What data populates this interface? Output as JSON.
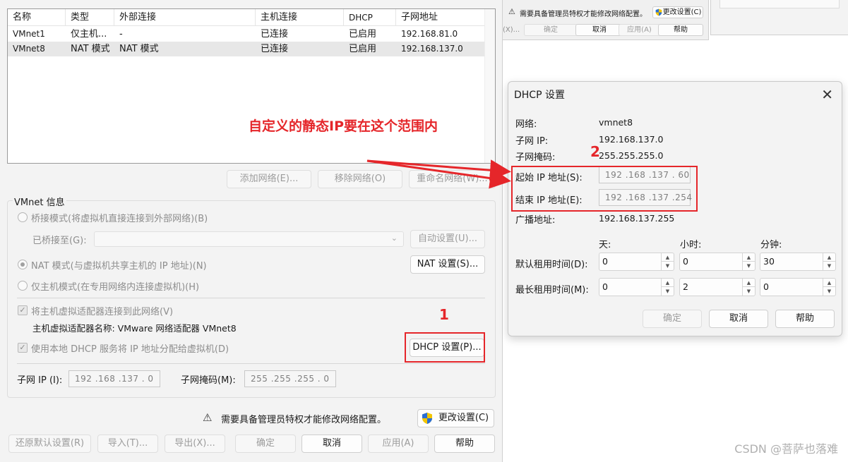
{
  "network_table": {
    "headers": [
      "名称",
      "类型",
      "外部连接",
      "主机连接",
      "DHCP",
      "子网地址"
    ],
    "rows": [
      {
        "name": "VMnet1",
        "type": "仅主机...",
        "external": "-",
        "host": "已连接",
        "dhcp": "已启用",
        "subnet": "192.168.81.0"
      },
      {
        "name": "VMnet8",
        "type": "NAT 模式",
        "external": "NAT 模式",
        "host": "已连接",
        "dhcp": "已启用",
        "subnet": "192.168.137.0"
      }
    ]
  },
  "table_buttons": {
    "add": "添加网络(E)...",
    "remove": "移除网络(O)",
    "rename": "重命名网络(W)..."
  },
  "vmnet_info": {
    "legend": "VMnet 信息",
    "bridged_label": "桥接模式(将虚拟机直接连接到外部网络)(B)",
    "bridged_to_label": "已桥接至(G):",
    "auto_settings": "自动设置(U)...",
    "nat_label": "NAT 模式(与虚拟机共享主机的 IP 地址)(N)",
    "nat_settings": "NAT 设置(S)...",
    "host_only_label": "仅主机模式(在专用网络内连接虚拟机)(H)",
    "connect_adapter_label": "将主机虚拟适配器连接到此网络(V)",
    "adapter_name_label": "主机虚拟适配器名称: VMware 网络适配器 VMnet8",
    "use_dhcp_label": "使用本地 DHCP 服务将 IP 地址分配给虚拟机(D)",
    "dhcp_settings": "DHCP 设置(P)...",
    "subnet_ip_label": "子网 IP (I):",
    "subnet_ip_value": "192 .168 .137 . 0",
    "subnet_mask_label": "子网掩码(M):",
    "subnet_mask_value": "255 .255 .255 . 0"
  },
  "admin_notice": {
    "text": "需要具备管理员特权才能修改网络配置。",
    "change_settings": "更改设置(C)"
  },
  "footer_buttons": {
    "restore": "还原默认设置(R)",
    "import": "导入(T)...",
    "export": "导出(X)...",
    "ok": "确定",
    "cancel": "取消",
    "apply": "应用(A)",
    "help": "帮助"
  },
  "back_window": {
    "notice": "需要具备管理员特权才能修改网络配置。",
    "change_settings": "更改设置(C)",
    "left_btn": "(X)...",
    "ok": "确定",
    "cancel": "取消",
    "apply": "应用(A)",
    "help": "帮助"
  },
  "dhcp_dialog": {
    "title": "DHCP 设置",
    "network_label": "网络:",
    "network_value": "vmnet8",
    "subnet_ip_label": "子网 IP:",
    "subnet_ip_value": "192.168.137.0",
    "subnet_mask_label": "子网掩码:",
    "subnet_mask_value": "255.255.255.0",
    "start_ip_label": "起始 IP 地址(S):",
    "start_ip_value": "192 .168 .137 . 60",
    "end_ip_label": "结束 IP 地址(E):",
    "end_ip_value": "192 .168 .137 .254",
    "broadcast_label": "广播地址:",
    "broadcast_value": "192.168.137.255",
    "col_days": "天:",
    "col_hours": "小时:",
    "col_minutes": "分钟:",
    "default_lease_label": "默认租用时间(D):",
    "default_lease": {
      "days": "0",
      "hours": "0",
      "minutes": "30"
    },
    "max_lease_label": "最长租用时间(M):",
    "max_lease": {
      "days": "0",
      "hours": "2",
      "minutes": "0"
    },
    "ok": "确定",
    "cancel": "取消",
    "help": "帮助"
  },
  "annotations": {
    "callout": "自定义的静态IP要在这个范围内",
    "num1": "1",
    "num2": "2",
    "color": "#e5262a"
  },
  "watermark": "CSDN @菩萨也落难"
}
